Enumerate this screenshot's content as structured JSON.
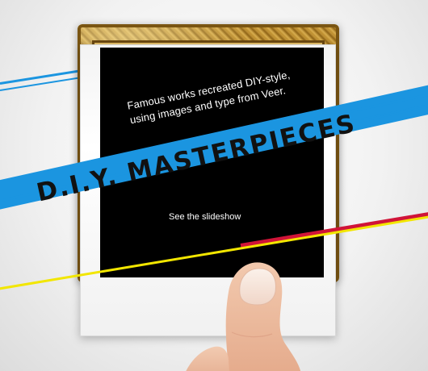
{
  "hero": {
    "subtitle": "Famous works recreated DIY-style,\nusing images and type from Veer.",
    "headline": "D.I.Y. MASTERPIECES",
    "link_label": "See the slideshow"
  },
  "colors": {
    "stripe_blue": "#1b95e0",
    "stripe_yellow": "#f2e600",
    "stripe_red": "#d01438",
    "frame_gold": "#c99b3e",
    "photo_black": "#000000",
    "polaroid_white": "#ffffff"
  }
}
